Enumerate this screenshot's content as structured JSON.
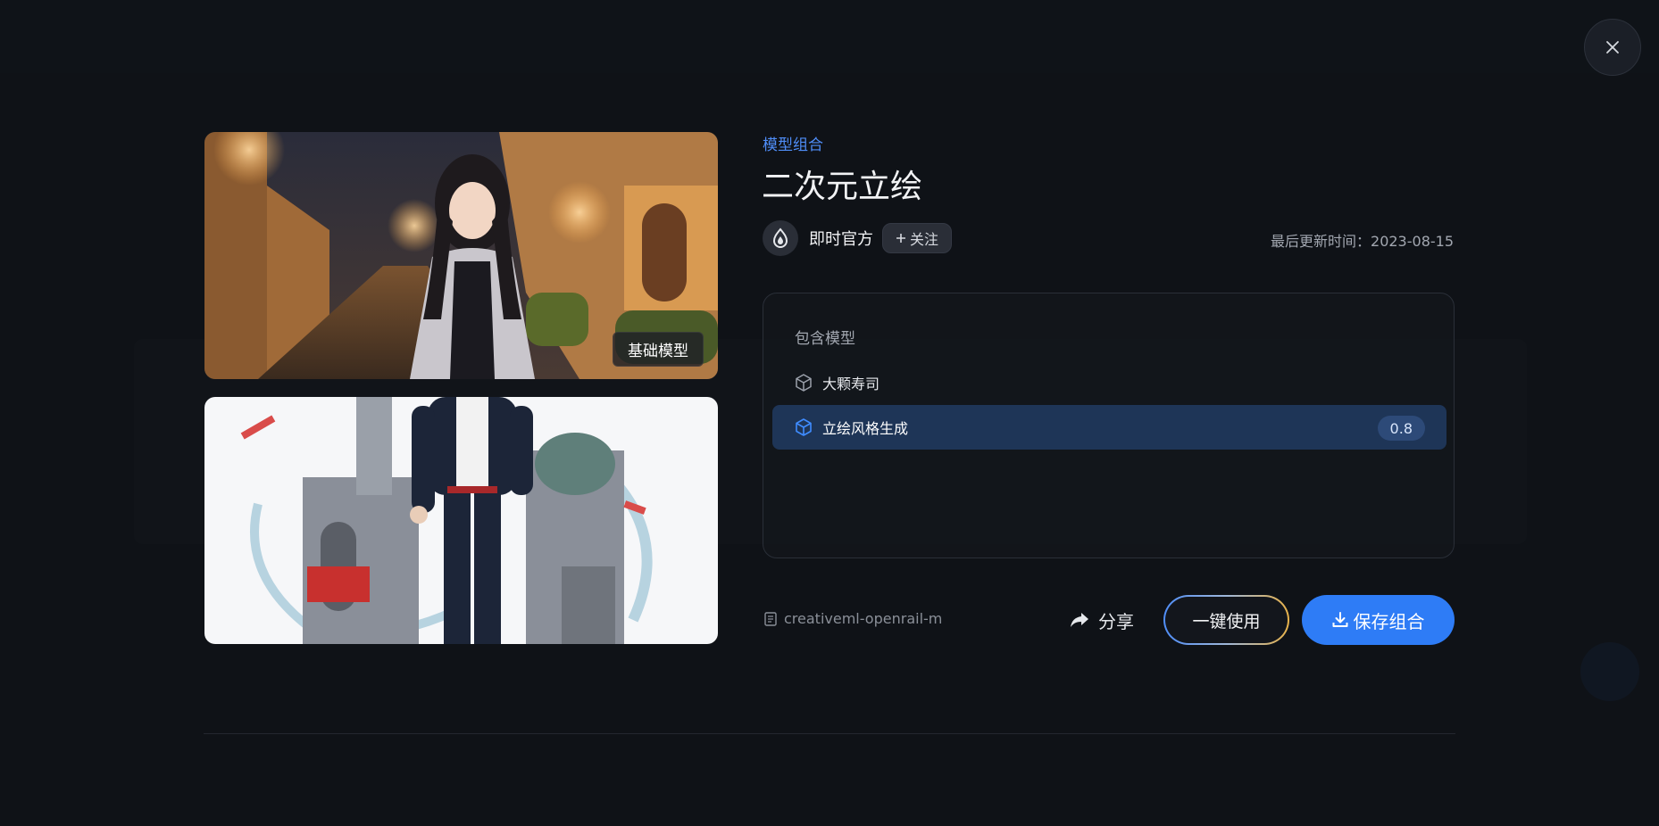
{
  "modal": {
    "category": "模型组合",
    "title": "二次元立绘",
    "author": {
      "name": "即时官方",
      "follow_label": "关注"
    },
    "updated_label": "最后更新时间：",
    "updated_date": "2023-08-15",
    "images": [
      {
        "tag": "基础模型"
      },
      {
        "tag": ""
      }
    ],
    "models": {
      "heading": "包含模型",
      "items": [
        {
          "name": "大颗寿司",
          "weight": "",
          "selected": false
        },
        {
          "name": "立绘风格生成",
          "weight": "0.8",
          "selected": true
        }
      ]
    },
    "license": "creativeml-openrail-m",
    "actions": {
      "share_label": "分享",
      "use_label": "一键使用",
      "save_label": "保存组合"
    }
  },
  "colors": {
    "accent": "#2e7cf6",
    "category_text": "#4f8df7",
    "selected_row": "#1e3557"
  },
  "icons": {
    "close": "close-icon",
    "author_logo": "brand-logo-icon",
    "model": "cube-icon",
    "license": "document-icon",
    "share": "share-arrow-icon",
    "save": "download-icon"
  }
}
